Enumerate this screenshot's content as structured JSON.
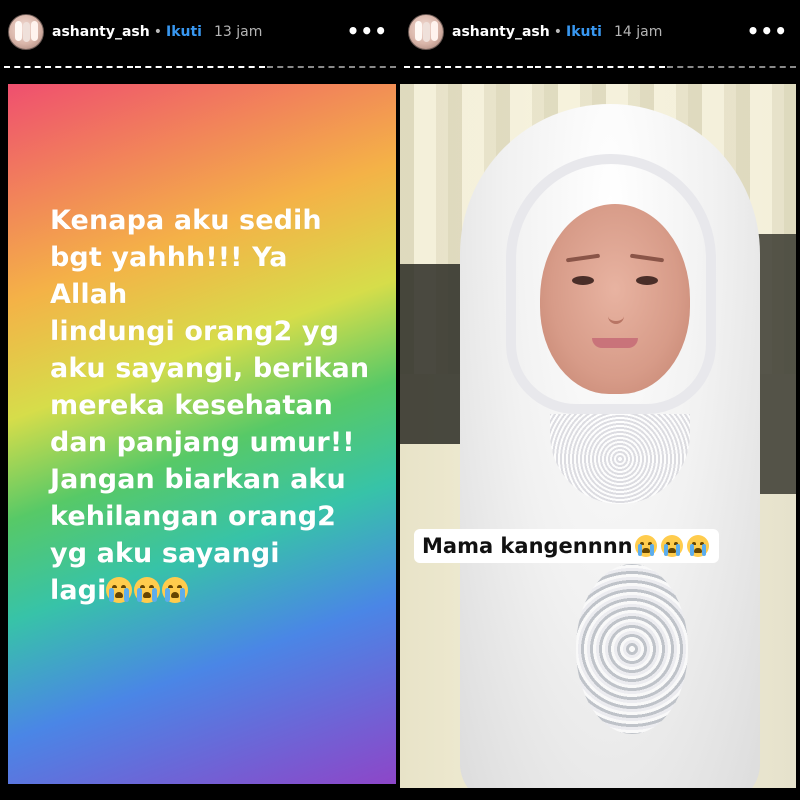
{
  "stories": [
    {
      "username": "ashanty_ash",
      "separator": "•",
      "follow_label": "Ikuti",
      "time": "13 jam",
      "more_icon": "•••",
      "text_lines": [
        "Kenapa aku sedih",
        "bgt yahhh!!! Ya Allah",
        "lindungi orang2 yg",
        "aku sayangi, berikan",
        "mereka kesehatan",
        "dan panjang umur!!",
        "Jangan biarkan aku",
        "kehilangan orang2",
        "yg aku sayangi",
        "lagi"
      ],
      "text_emoji": [
        "loudly-crying-face",
        "loudly-crying-face",
        "loudly-crying-face"
      ],
      "background": [
        "#ef4f6f",
        "#f4b247",
        "#57c967",
        "#4a86e6",
        "#8d46c8"
      ]
    },
    {
      "username": "ashanty_ash",
      "separator": "•",
      "follow_label": "Ikuti",
      "time": "14 jam",
      "more_icon": "•••",
      "caption": "Mama kangennnn",
      "caption_emoji": [
        "loudly-crying-face",
        "loudly-crying-face",
        "loudly-crying-face"
      ]
    }
  ],
  "colors": {
    "follow": "#3897f0",
    "background": "#000000"
  }
}
